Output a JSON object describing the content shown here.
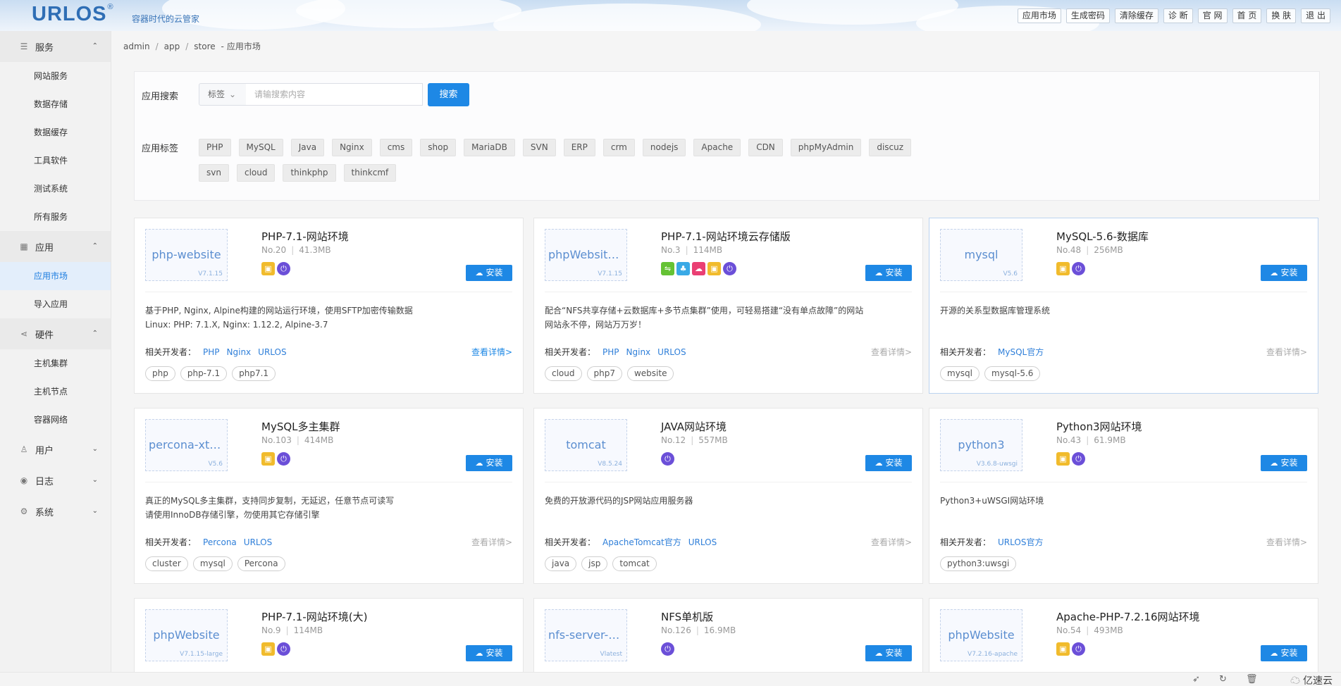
{
  "header": {
    "logo": "URLOS",
    "logo_mark": "®",
    "slogan": "容器时代的云管家",
    "nav": [
      "应用市场",
      "生成密码",
      "清除缓存",
      "诊 断",
      "官 网",
      "首 页",
      "换 肤",
      "退 出"
    ]
  },
  "sidebar": {
    "sections": [
      {
        "label": "服务",
        "icon": "server-icon",
        "chev": "⌃",
        "items": [
          "网站服务",
          "数据存储",
          "数据缓存",
          "工具软件",
          "测试系统",
          "所有服务"
        ]
      },
      {
        "label": "应用",
        "icon": "apps-grid-icon",
        "chev": "⌃",
        "items": [
          "应用市场",
          "导入应用"
        ]
      },
      {
        "label": "硬件",
        "icon": "share-nodes-icon",
        "chev": "⌃",
        "items": [
          "主机集群",
          "主机节点",
          "容器网络"
        ]
      },
      {
        "label": "用户",
        "icon": "user-icon",
        "chev": "⌄",
        "items": []
      },
      {
        "label": "日志",
        "icon": "eye-icon",
        "chev": "⌄",
        "items": []
      },
      {
        "label": "系统",
        "icon": "gear-icon",
        "chev": "⌄",
        "items": []
      }
    ],
    "active_item": "应用市场"
  },
  "breadcrumb": {
    "items": [
      "admin",
      "app",
      "store"
    ],
    "current": "应用市场",
    "sep": "/",
    "dash": "-"
  },
  "search": {
    "label": "应用搜索",
    "select_value": "标签",
    "placeholder": "请输搜索内容",
    "button": "搜索",
    "tags_label": "应用标签",
    "tags_row1": [
      "PHP",
      "MySQL",
      "Java",
      "Nginx",
      "cms",
      "shop",
      "MariaDB",
      "SVN",
      "ERP",
      "crm",
      "nodejs",
      "Apache",
      "CDN",
      "phpMyAdmin",
      "discuz"
    ],
    "tags_row2": [
      "svn",
      "cloud",
      "thinkphp",
      "thinkcmf"
    ]
  },
  "install_label": "安装",
  "detail_label": "查看详情>",
  "dev_label": "相关开发者：",
  "cards": [
    {
      "thumb": "php-website",
      "version": "V7.1.15",
      "title": "PHP-7.1-网站环境",
      "no": "No.20",
      "size": "41.3MB",
      "icons": [
        "yel",
        "pur"
      ],
      "desc": [
        "基于PHP, Nginx, Alpine构建的网站运行环境，使用SFTP加密传输数据",
        "Linux: PHP: 7.1.X, Nginx: 1.12.2, Alpine-3.7"
      ],
      "devs": [
        "PHP",
        "Nginx",
        "URLOS"
      ],
      "tags": [
        "php",
        "php-7.1",
        "php7.1"
      ],
      "detail_on": true,
      "highlight": false
    },
    {
      "thumb": "phpWebsiteCloud",
      "version": "V7.1.15",
      "title": "PHP-7.1-网站环境云存储版",
      "no": "No.3",
      "size": "114MB",
      "icons": [
        "grn",
        "blu",
        "red",
        "yel",
        "pur"
      ],
      "desc": [
        "配合“NFS共享存储+云数据库+多节点集群”使用，可轻易搭建“没有单点故障”的网站",
        "网站永不停，网站万万岁！"
      ],
      "devs": [
        "PHP",
        "Nginx",
        "URLOS"
      ],
      "tags": [
        "cloud",
        "php7",
        "website"
      ],
      "detail_on": false,
      "highlight": false
    },
    {
      "thumb": "mysql",
      "version": "V5.6",
      "title": "MySQL-5.6-数据库",
      "no": "No.48",
      "size": "256MB",
      "icons": [
        "yel",
        "pur"
      ],
      "desc": [
        "开源的关系型数据库管理系统"
      ],
      "devs": [
        "MySQL官方"
      ],
      "tags": [
        "mysql",
        "mysql-5.6"
      ],
      "detail_on": false,
      "highlight": true
    },
    {
      "thumb": "percona-xtradb-cl...",
      "version": "V5.6",
      "title": "MySQL多主集群",
      "no": "No.103",
      "size": "414MB",
      "icons": [
        "yel",
        "pur"
      ],
      "desc": [
        "真正的MySQL多主集群，支持同步复制，无延迟，任意节点可读写",
        "请使用InnoDB存储引擎，勿使用其它存储引擎"
      ],
      "devs": [
        "Percona",
        "URLOS"
      ],
      "tags": [
        "cluster",
        "mysql",
        "Percona"
      ],
      "detail_on": false,
      "highlight": false
    },
    {
      "thumb": "tomcat",
      "version": "V8.5.24",
      "title": "JAVA网站环境",
      "no": "No.12",
      "size": "557MB",
      "icons": [
        "pur"
      ],
      "desc": [
        "免费的开放源代码的JSP网站应用服务器"
      ],
      "devs": [
        "ApacheTomcat官方",
        "URLOS"
      ],
      "tags": [
        "java",
        "jsp",
        "tomcat"
      ],
      "detail_on": false,
      "highlight": false
    },
    {
      "thumb": "python3",
      "version": "V3.6.8-uwsgi",
      "title": "Python3网站环境",
      "no": "No.43",
      "size": "61.9MB",
      "icons": [
        "yel",
        "pur"
      ],
      "desc": [
        "Python3+uWSGI网站环境"
      ],
      "devs": [
        "URLOS官方"
      ],
      "tags": [
        "python3:uwsgi"
      ],
      "detail_on": false,
      "highlight": false
    },
    {
      "thumb": "phpWebsite",
      "version": "V7.1.15-large",
      "title": "PHP-7.1-网站环境(大)",
      "no": "No.9",
      "size": "114MB",
      "icons": [
        "yel",
        "pur"
      ],
      "desc": [],
      "devs": [],
      "tags": [],
      "detail_on": false,
      "highlight": false
    },
    {
      "thumb": "nfs-server-alpine",
      "version": "Vlatest",
      "title": "NFS单机版",
      "no": "No.126",
      "size": "16.9MB",
      "icons": [
        "pur"
      ],
      "desc": [],
      "devs": [],
      "tags": [],
      "detail_on": false,
      "highlight": false
    },
    {
      "thumb": "phpWebsite",
      "version": "V7.2.16-apache",
      "title": "Apache-PHP-7.2.16网站环境",
      "no": "No.54",
      "size": "493MB",
      "icons": [
        "yel",
        "pur"
      ],
      "desc": [],
      "devs": [],
      "tags": [],
      "detail_on": false,
      "highlight": false
    }
  ],
  "footer": {
    "brand": "亿速云",
    "icons": [
      "rocket-icon",
      "refresh-icon",
      "trash-icon"
    ]
  }
}
